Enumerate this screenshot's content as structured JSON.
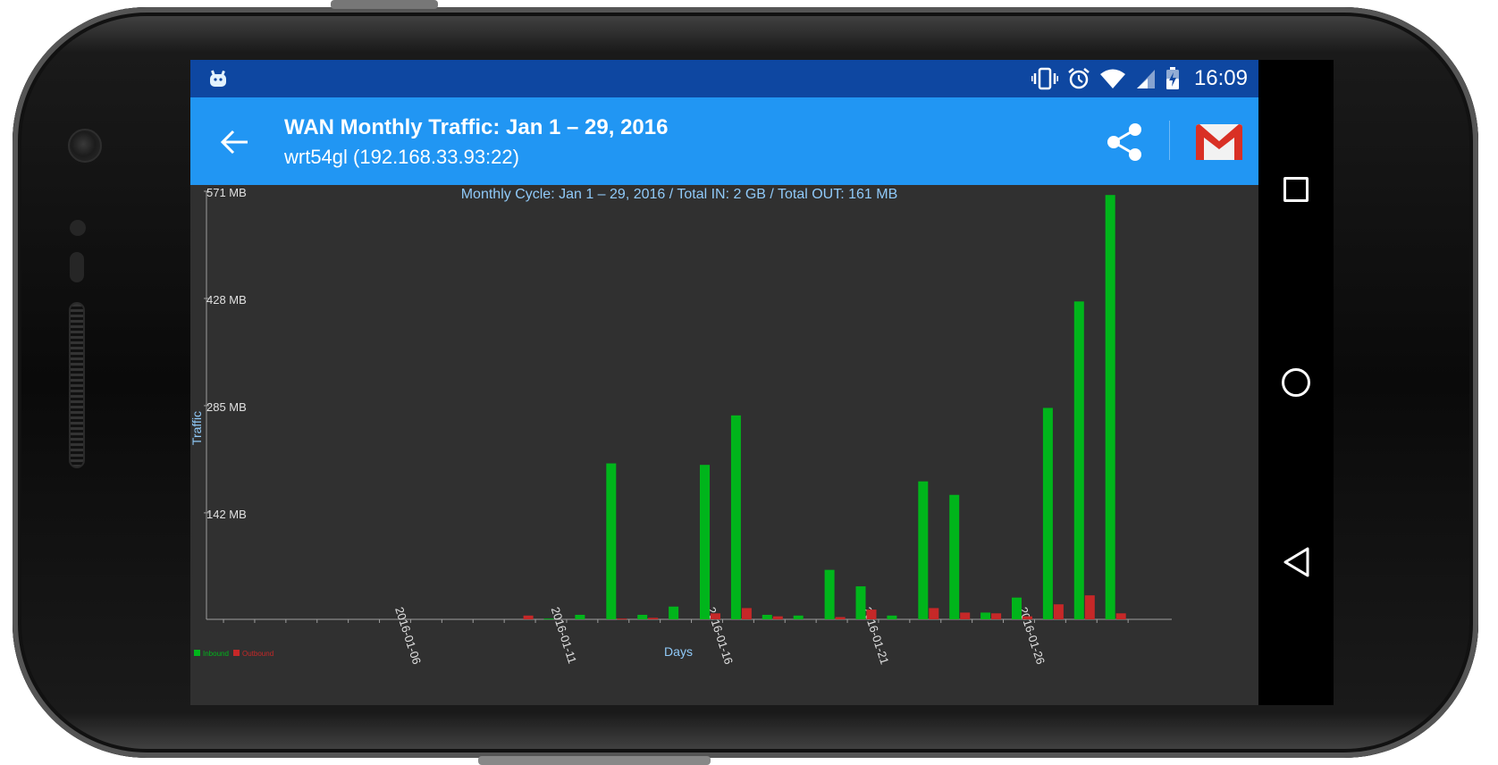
{
  "status_bar": {
    "time": "16:09",
    "icons": [
      "android-icon",
      "vibrate-icon",
      "alarm-icon",
      "wifi-icon",
      "signal-icon",
      "battery-charging-icon"
    ]
  },
  "app_bar": {
    "title": "WAN Monthly Traffic: Jan 1 – 29, 2016",
    "subtitle": "wrt54gl (192.168.33.93:22)",
    "actions": [
      "share-icon",
      "gmail-icon"
    ]
  },
  "nav_bar": {
    "buttons": [
      "recents-icon",
      "home-icon",
      "back-icon"
    ]
  },
  "colors": {
    "status_bar": "#0e47a1",
    "app_bar": "#2196f3",
    "chart_background": "#303030",
    "inbound": "#00b51b",
    "outbound": "#c62828",
    "label": "#90caf9"
  },
  "chart_data": {
    "type": "bar",
    "title": "Monthly Cycle: Jan 1 – 29, 2016 / Total IN: 2 GB / Total OUT: 161 MB",
    "xlabel": "Days",
    "ylabel": "Traffic",
    "ylim": [
      0,
      571
    ],
    "y_unit": "MB",
    "yticks": [
      "571 MB",
      "428 MB",
      "285 MB",
      "142 MB"
    ],
    "ytick_values": [
      571,
      428,
      285,
      142
    ],
    "xticks": [
      "2016-01-06",
      "2016-01-11",
      "2016-01-16",
      "2016-01-21",
      "2016-01-26"
    ],
    "xtick_days": [
      6,
      11,
      16,
      21,
      26
    ],
    "days": [
      1,
      2,
      3,
      4,
      5,
      6,
      7,
      8,
      9,
      10,
      11,
      12,
      13,
      14,
      15,
      16,
      17,
      18,
      19,
      20,
      21,
      22,
      23,
      24,
      25,
      26,
      27,
      28,
      29
    ],
    "grid": false,
    "legend_position": "bottom-left",
    "series": [
      {
        "name": "Inbound",
        "color": "#00b51b",
        "values": [
          0,
          0,
          0,
          0,
          0,
          0,
          0,
          0,
          0,
          0,
          1,
          6,
          208,
          6,
          17,
          206,
          272,
          6,
          5,
          66,
          44,
          5,
          184,
          166,
          9,
          29,
          282,
          424,
          566
        ]
      },
      {
        "name": "Outbound",
        "color": "#c62828",
        "values": [
          0,
          0,
          0,
          0,
          0,
          0,
          0,
          0,
          0,
          5,
          0,
          0,
          1,
          2,
          0,
          8,
          15,
          4,
          0,
          3,
          13,
          0,
          15,
          9,
          8,
          4,
          20,
          32,
          8
        ]
      }
    ]
  }
}
